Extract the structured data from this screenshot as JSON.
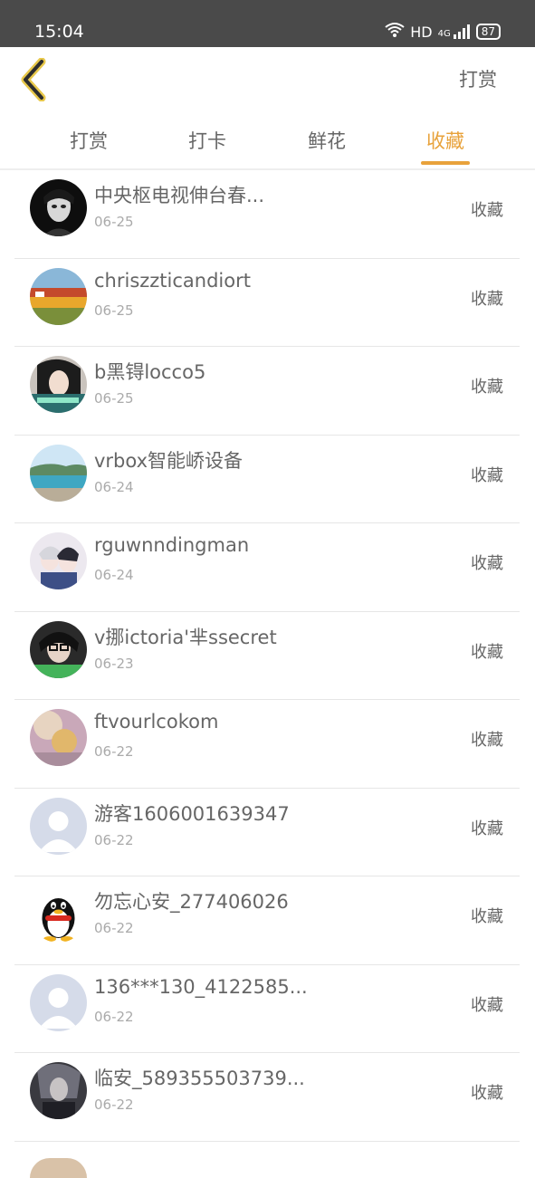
{
  "status": {
    "time": "15:04",
    "network": "HD",
    "signal": "4G",
    "battery": "87"
  },
  "nav": {
    "action_label": "打赏"
  },
  "tabs": [
    {
      "label": "打赏",
      "active": false
    },
    {
      "label": "打卡",
      "active": false
    },
    {
      "label": "鲜花",
      "active": false
    },
    {
      "label": "收藏",
      "active": true
    }
  ],
  "colors": {
    "accent": "#e8a23b",
    "statusbar": "#4a4a4a"
  },
  "items": [
    {
      "name": "中央枢电视伸台春...",
      "date": "06-25",
      "action": "收藏",
      "avatar": "portrait-dark"
    },
    {
      "name": "chriszzticandiort",
      "date": "06-25",
      "action": "收藏",
      "avatar": "landscape-colorful"
    },
    {
      "name": "b黑锝locco5",
      "date": "06-25",
      "action": "收藏",
      "avatar": "girl-portrait"
    },
    {
      "name": "vrbox智能峤设备",
      "date": "06-24",
      "action": "收藏",
      "avatar": "beach-landscape"
    },
    {
      "name": "rguwnndingman",
      "date": "06-24",
      "action": "收藏",
      "avatar": "anime-couple"
    },
    {
      "name": "v挪ictoria'芈ssecret",
      "date": "06-23",
      "action": "收藏",
      "avatar": "girl-glasses"
    },
    {
      "name": "ftvourlcokom",
      "date": "06-22",
      "action": "收藏",
      "avatar": "warm-soft-photo"
    },
    {
      "name": "游客1606001639347",
      "date": "06-22",
      "action": "收藏",
      "avatar": "default-user"
    },
    {
      "name": "勿忘心安_277406026",
      "date": "06-22",
      "action": "收藏",
      "avatar": "qq-penguin"
    },
    {
      "name": "136***130_4122585...",
      "date": "06-22",
      "action": "收藏",
      "avatar": "default-user"
    },
    {
      "name": "临安_589355503739...",
      "date": "06-22",
      "action": "收藏",
      "avatar": "dark-photo"
    }
  ]
}
